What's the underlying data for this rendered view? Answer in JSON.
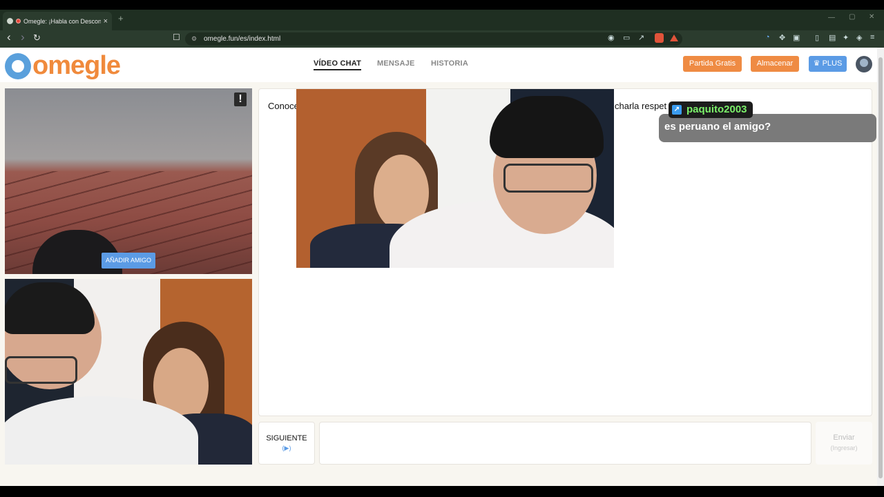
{
  "browser": {
    "tab_title": "Omegle: ¡Habla con Desconoc",
    "tab_close": "×",
    "new_tab": "+",
    "url": "omegle.fun/es/index.html",
    "nav_back": "‹",
    "nav_forward": "›",
    "nav_reload": "↻"
  },
  "site": {
    "logo_text": "omegle",
    "menu": [
      {
        "label": "VÍDEO CHAT",
        "active": true
      },
      {
        "label": "MENSAJE",
        "active": false
      },
      {
        "label": "HISTORIA",
        "active": false
      }
    ],
    "buttons": {
      "free_match": "Partida Gratis",
      "store": "Almacenar",
      "plus": "♛ PLUS"
    }
  },
  "video": {
    "alert_icon": "!",
    "add_friend": "AÑADIR AMIGO"
  },
  "chat": {
    "intro_left": "Conoce",
    "intro_right": "charla respet",
    "overlay_username": "paquito2003",
    "overlay_badge": "↗",
    "overlay_message": "es peruano el amigo?"
  },
  "controls": {
    "next_label": "SIGUIENTE",
    "next_hint": "(▶)",
    "send_label": "Enviar",
    "send_hint": "(Ingresar)",
    "message_placeholder": ""
  },
  "colors": {
    "brand_orange": "#f08a3c",
    "brand_blue": "#5b9be5",
    "browser_chrome": "#2b3c2e"
  }
}
